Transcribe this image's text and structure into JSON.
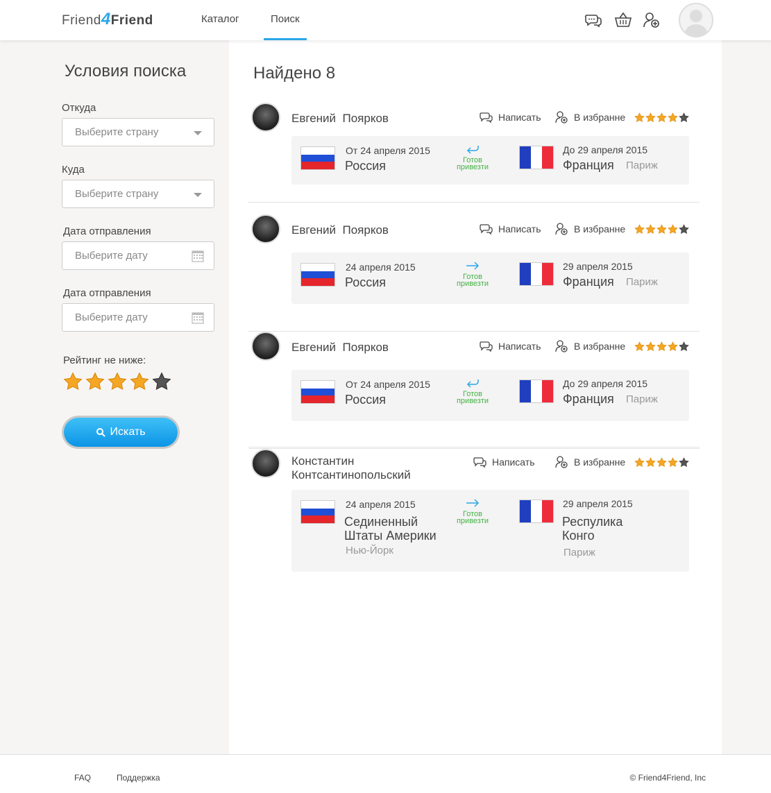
{
  "header": {
    "logo": {
      "part1": "Friend",
      "part2": "4",
      "part3": "Friend"
    },
    "nav": [
      "Каталог",
      "Поиск"
    ],
    "active_nav": "Поиск"
  },
  "sidebar": {
    "title": "Условия поиска",
    "from_label": "Откуда",
    "from_placeholder": "Выберите страну",
    "to_label": "Куда",
    "to_placeholder": "Выберите страну",
    "date1_label": "Дата отправления",
    "date1_placeholder": "Выберите дату",
    "date2_label": "Дата отправления",
    "date2_placeholder": "Выберите дату",
    "rating_label": "Рейтинг не ниже:",
    "rating_value": 4,
    "rating_max": 5,
    "search_button": "Искать"
  },
  "main": {
    "found": "Найдено 8",
    "results": [
      {
        "first": "Евгений",
        "last": "Поярков",
        "write": "Написать",
        "fav": "В избранне",
        "rating": 4,
        "from_date": "От 24 апреля 2015",
        "from_country": "Россия",
        "from_city": "",
        "to_date": "До 29 апреля 2015",
        "to_country": "Франция",
        "to_city": "Париж",
        "ready": "Готов привезти",
        "arrow": "return"
      },
      {
        "first": "Евгений",
        "last": "Поярков",
        "write": "Написать",
        "fav": "В избранне",
        "rating": 4,
        "from_date": "24 апреля 2015",
        "from_country": "Россия",
        "from_city": "",
        "to_date": "29 апреля 2015",
        "to_country": "Франция",
        "to_city": "Париж",
        "ready": "Готов привезти",
        "arrow": "forward"
      },
      {
        "first": "Евгений",
        "last": "Поярков",
        "write": "Написать",
        "fav": "В избранне",
        "rating": 4,
        "from_date": "От 24 апреля 2015",
        "from_country": "Россия",
        "from_city": "",
        "to_date": "До 29 апреля 2015",
        "to_country": "Франция",
        "to_city": "Париж",
        "ready": "Готов привезти",
        "arrow": "return"
      },
      {
        "first": "Константин",
        "last": "Контсантинопольский",
        "write": "Написать",
        "fav": "В избранне",
        "rating": 4,
        "from_date": "24 апреля 2015",
        "from_country": "Сединенный Штаты Америки",
        "from_city": "Нью-Йорк",
        "to_date": "29 апреля 2015",
        "to_country": "Респулика Конго",
        "to_city": "Париж",
        "ready": "Готов привезти",
        "arrow": "forward"
      }
    ]
  },
  "footer": {
    "faq": "FAQ",
    "support": "Поддержка",
    "copyright": "© Friend4Friend, Inc"
  },
  "colors": {
    "accent": "#2aa7e8",
    "star": "#f5a623",
    "ready_green": "#44b244"
  }
}
